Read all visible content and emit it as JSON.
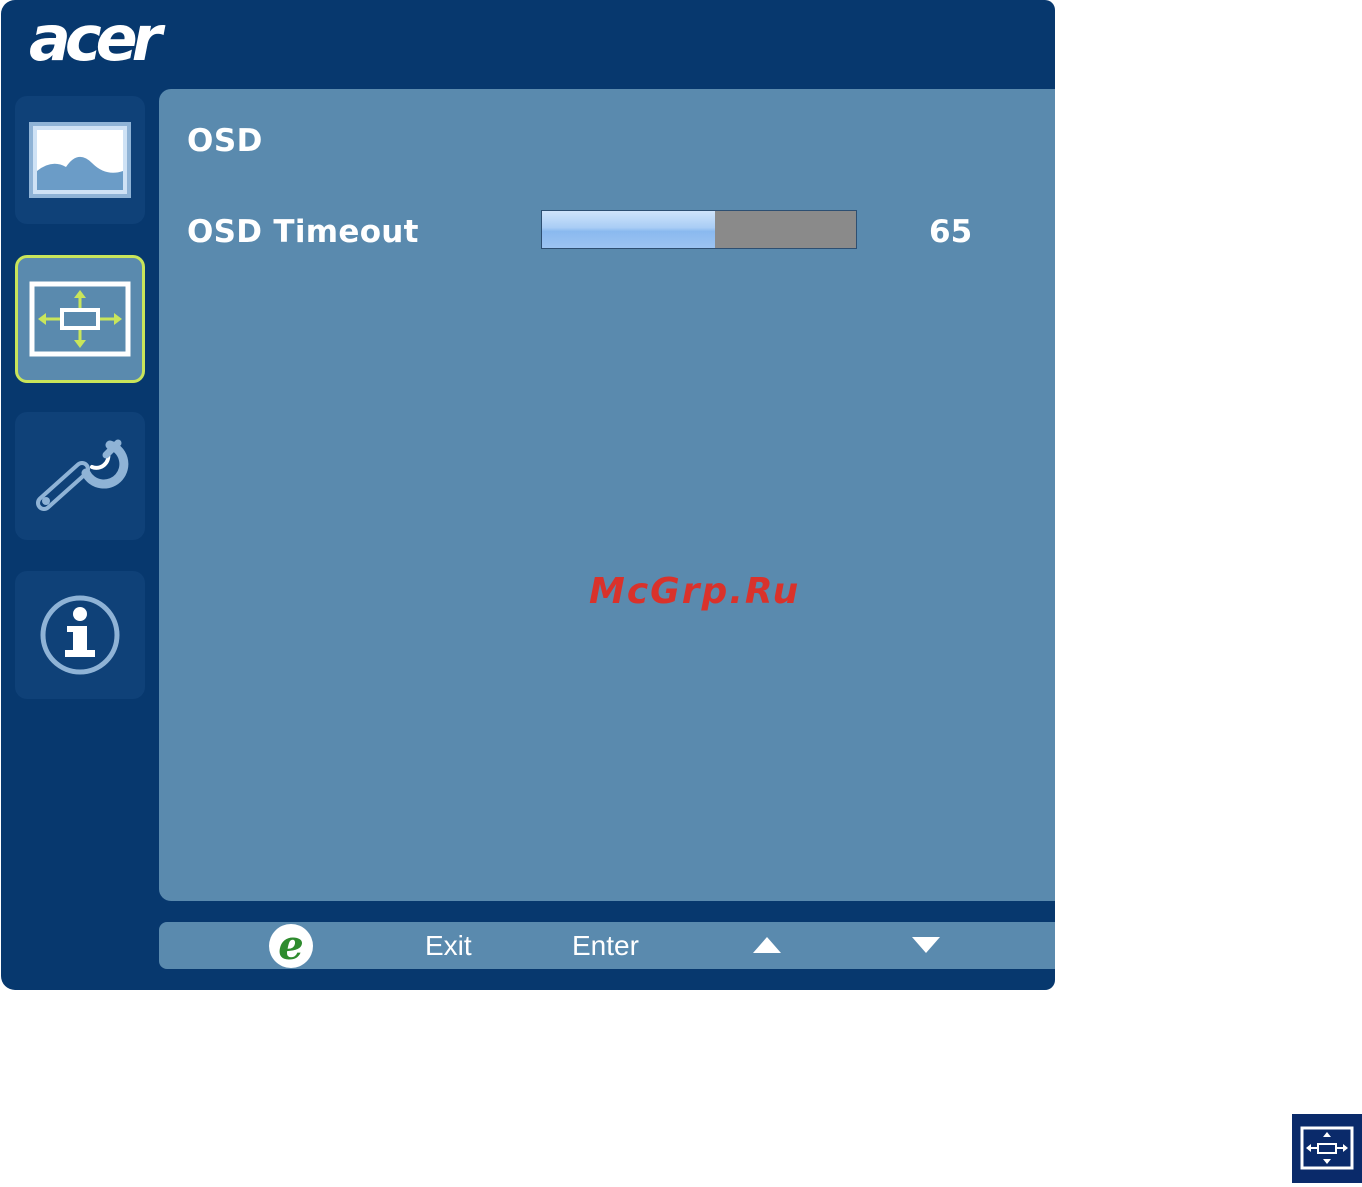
{
  "brand": {
    "logo_text": "acer"
  },
  "sidebar": {
    "items": [
      {
        "icon": "picture-icon",
        "active": false
      },
      {
        "icon": "osd-position-icon",
        "active": true
      },
      {
        "icon": "settings-wrench-icon",
        "active": false
      },
      {
        "icon": "information-icon",
        "active": false
      }
    ]
  },
  "panel": {
    "title": "OSD",
    "settings": [
      {
        "label": "OSD Timeout",
        "value": "65",
        "level": 0.55
      }
    ]
  },
  "watermark": "McGrp.Ru",
  "footer": {
    "exit_label": "Exit",
    "enter_label": "Enter",
    "icons": [
      "empowering-e-icon",
      "arrow-up-icon",
      "arrow-down-icon"
    ]
  },
  "colors": {
    "frame": "#07386e",
    "panel": "#5a8aae",
    "active_border": "#c9e55a",
    "slider_fill": "#a9cdf5",
    "slider_track": "#8a8a8a",
    "watermark": "#d9322b"
  }
}
